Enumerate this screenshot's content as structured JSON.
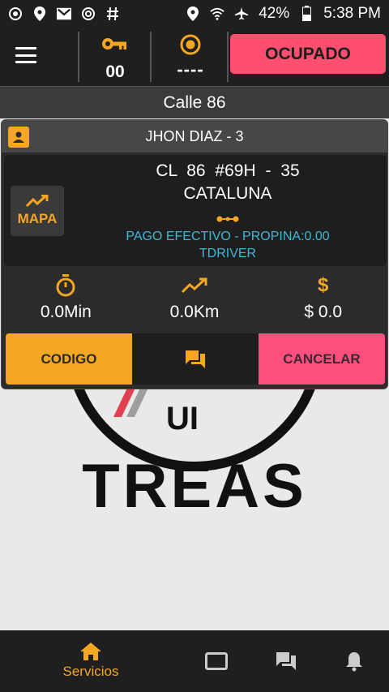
{
  "statusbar": {
    "battery": "42%",
    "time": "5:38 PM",
    "left_icons": [
      "sync-icon",
      "location-pin-icon",
      "gmail-icon",
      "sync-alt-icon",
      "hash-icon"
    ],
    "right_icons": [
      "location-pin-icon",
      "wifi-icon",
      "airplane-icon",
      "battery-icon"
    ]
  },
  "appbar": {
    "key_count": "00",
    "record_value": "----",
    "status_button": "OCUPADO"
  },
  "street": "Calle 86",
  "card": {
    "client": "JHON DIAZ - 3",
    "map_label": "MAPA",
    "address_line1": "CL 86   #69H   - 35",
    "address_line2": "CATALUNA",
    "payment": "PAGO EFECTIVO - PROPINA:0.00",
    "driver": "TDRIVER",
    "metrics": {
      "time": "0.0Min",
      "distance": "0.0Km",
      "money_symbol": "$",
      "price": "$ 0.0"
    },
    "actions": {
      "code": "CODIGO",
      "cancel": "CANCELAR"
    }
  },
  "logo": {
    "text": "TREAS",
    "fragment": "UI"
  },
  "bottomnav": {
    "home_label": "Servicios"
  },
  "colors": {
    "accent": "#f5a623",
    "danger": "#ff4f6e",
    "info": "#3fb8d8",
    "bar": "#1f1f1f"
  }
}
